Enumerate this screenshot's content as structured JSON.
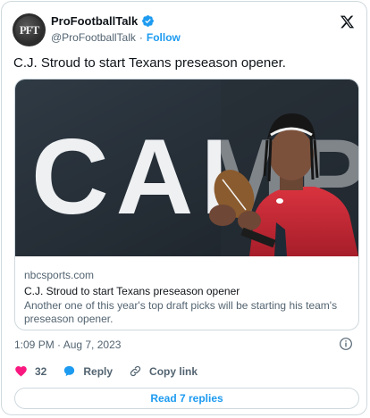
{
  "author": {
    "display_name": "ProFootballTalk",
    "handle": "@ProFootballTalk",
    "separator": "·",
    "follow_label": "Follow",
    "avatar_text": "PFT",
    "verified": true
  },
  "tweet": {
    "text": "C.J. Stroud to start Texans preseason opener.",
    "timestamp": "1:09 PM · Aug 7, 2023"
  },
  "link_card": {
    "domain": "nbcsports.com",
    "title": "C.J. Stroud to start Texans preseason opener",
    "description": "Another one of this year's top draft picks will be starting his team's preseason opener.",
    "image_text": "CAMP"
  },
  "actions": {
    "like_count": "32",
    "reply_label": "Reply",
    "copy_link_label": "Copy link"
  },
  "read_replies_label": "Read 7 replies",
  "colors": {
    "accent": "#1d9bf0",
    "like": "#f91880",
    "text": "#0f1419",
    "secondary": "#536471",
    "border": "#cfd9de"
  }
}
